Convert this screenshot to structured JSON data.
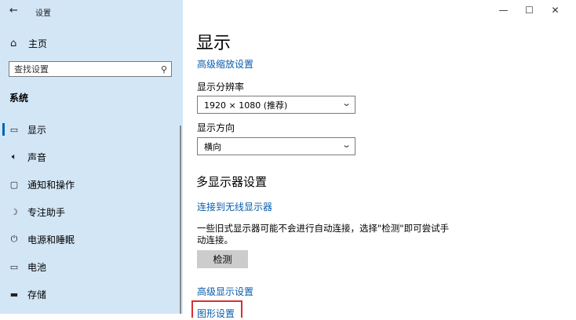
{
  "window": {
    "title": "设置",
    "back_icon": "←",
    "controls": {
      "minimize": "—",
      "maximize": "☐",
      "close": "✕"
    }
  },
  "sidebar": {
    "home": {
      "label": "主页",
      "icon": "home-icon"
    },
    "search": {
      "placeholder": "查找设置",
      "icon": "search-icon"
    },
    "section": "系统",
    "items": [
      {
        "label": "显示",
        "icon": "display-icon",
        "active": true
      },
      {
        "label": "声音",
        "icon": "speaker-icon",
        "active": false
      },
      {
        "label": "通知和操作",
        "icon": "notification-icon",
        "active": false
      },
      {
        "label": "专注助手",
        "icon": "moon-icon",
        "active": false
      },
      {
        "label": "电源和睡眠",
        "icon": "power-icon",
        "active": false
      },
      {
        "label": "电池",
        "icon": "battery-icon",
        "active": false
      },
      {
        "label": "存储",
        "icon": "storage-icon",
        "active": false
      }
    ]
  },
  "main": {
    "title": "显示",
    "advanced_scaling_link": "高级缩放设置",
    "resolution": {
      "label": "显示分辨率",
      "value": "1920 × 1080 (推荐)"
    },
    "orientation": {
      "label": "显示方向",
      "value": "横向"
    },
    "multi_display": {
      "title": "多显示器设置",
      "connect_link": "连接到无线显示器",
      "description": "一些旧式显示器可能不会进行自动连接，选择\"检测\"即可尝试手动连接。",
      "detect_button": "检测"
    },
    "advanced_display_link": "高级显示设置",
    "graphics_settings_link": "图形设置"
  },
  "colors": {
    "accent": "#0063b1",
    "link": "#0a5dab",
    "sidebar_bg": "#d3e6f6",
    "highlight": "#d8302f"
  }
}
